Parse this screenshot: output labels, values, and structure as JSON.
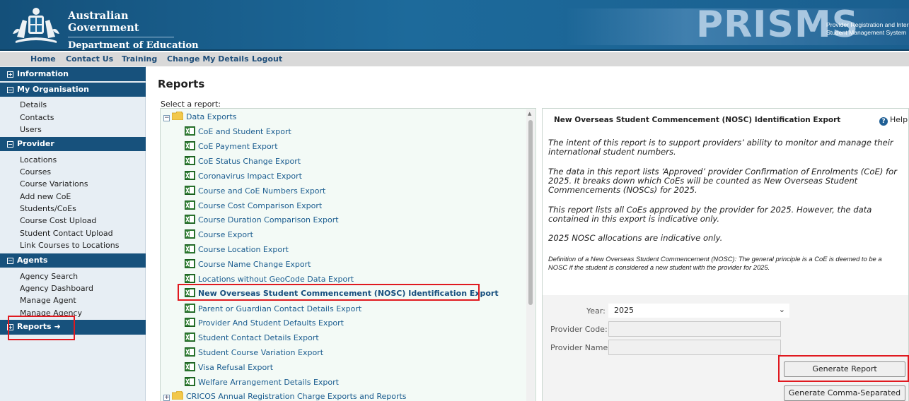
{
  "header": {
    "gov_line1": "Australian Government",
    "gov_line2": "Department of Education",
    "brand": "PRISMS",
    "brand_sub_line1": "Provider Registration and Internat",
    "brand_sub_line2": "Student Management System"
  },
  "topnav": [
    "Home",
    "Contact Us",
    "Training",
    "Change My Details",
    "Logout"
  ],
  "sidebar": {
    "information": "Information",
    "my_organisation": "My Organisation",
    "org_items": [
      "Details",
      "Contacts",
      "Users"
    ],
    "provider": "Provider",
    "provider_items": [
      "Locations",
      "Courses",
      "Course Variations",
      "Add new CoE",
      "Students/CoEs",
      "Course Cost Upload",
      "Student Contact Upload",
      "Link Courses to Locations"
    ],
    "agents": "Agents",
    "agent_items": [
      "Agency Search",
      "Agency Dashboard",
      "Manage Agent",
      "Manage Agency"
    ],
    "reports": "Reports",
    "reports_arrow": "➜"
  },
  "main": {
    "title": "Reports",
    "select_label": "Select a report:",
    "tree": {
      "folder1": "Data Exports",
      "items": [
        "CoE and Student Export",
        "CoE Payment Export",
        "CoE Status Change Export",
        "Coronavirus Impact Export",
        "Course and CoE Numbers Export",
        "Course Cost Comparison Export",
        "Course Duration Comparison Export",
        "Course Export",
        "Course Location Export",
        "Course Name Change Export",
        "Locations without GeoCode Data Export",
        "New Overseas Student Commencement (NOSC) Identification Export",
        "Parent or Guardian Contact Details Export",
        "Provider And Student Defaults Export",
        "Student Contact Details Export",
        "Student Course Variation Export",
        "Visa Refusal Export",
        "Welfare Arrangement Details Export"
      ],
      "folder2": "CRICOS Annual Registration Charge Exports and Reports"
    }
  },
  "panel": {
    "title": "New Overseas Student Commencement (NOSC) Identification Export",
    "help": "Help",
    "p1": "The intent of this report is to support providers’ ability to monitor and manage their international student numbers.",
    "p2": "The data in this report lists ‘Approved’ provider Confirmation of Enrolments (CoE) for 2025. It breaks down which CoEs will be counted as New Overseas Student Commencements (NOSCs) for 2025.",
    "p3": "This report lists all CoEs approved by the provider for 2025. However, the data contained in this export is indicative only.",
    "p4": "2025 NOSC allocations are indicative only.",
    "p5": "Definition of a New Overseas Student Commencement (NOSC): The general principle is a CoE is deemed to be a NOSC if the student is considered a new student with the provider for 2025.",
    "year_label": "Year:",
    "year_value": "2025",
    "provider_code_label": "Provider Code:",
    "provider_name_label": "Provider Name:",
    "generate_report": "Generate Report",
    "generate_csv": "Generate Comma-Separated"
  },
  "colors": {
    "header_blue": "#17517c",
    "link_blue": "#1a5c8f",
    "highlight_red": "#e0191f"
  }
}
